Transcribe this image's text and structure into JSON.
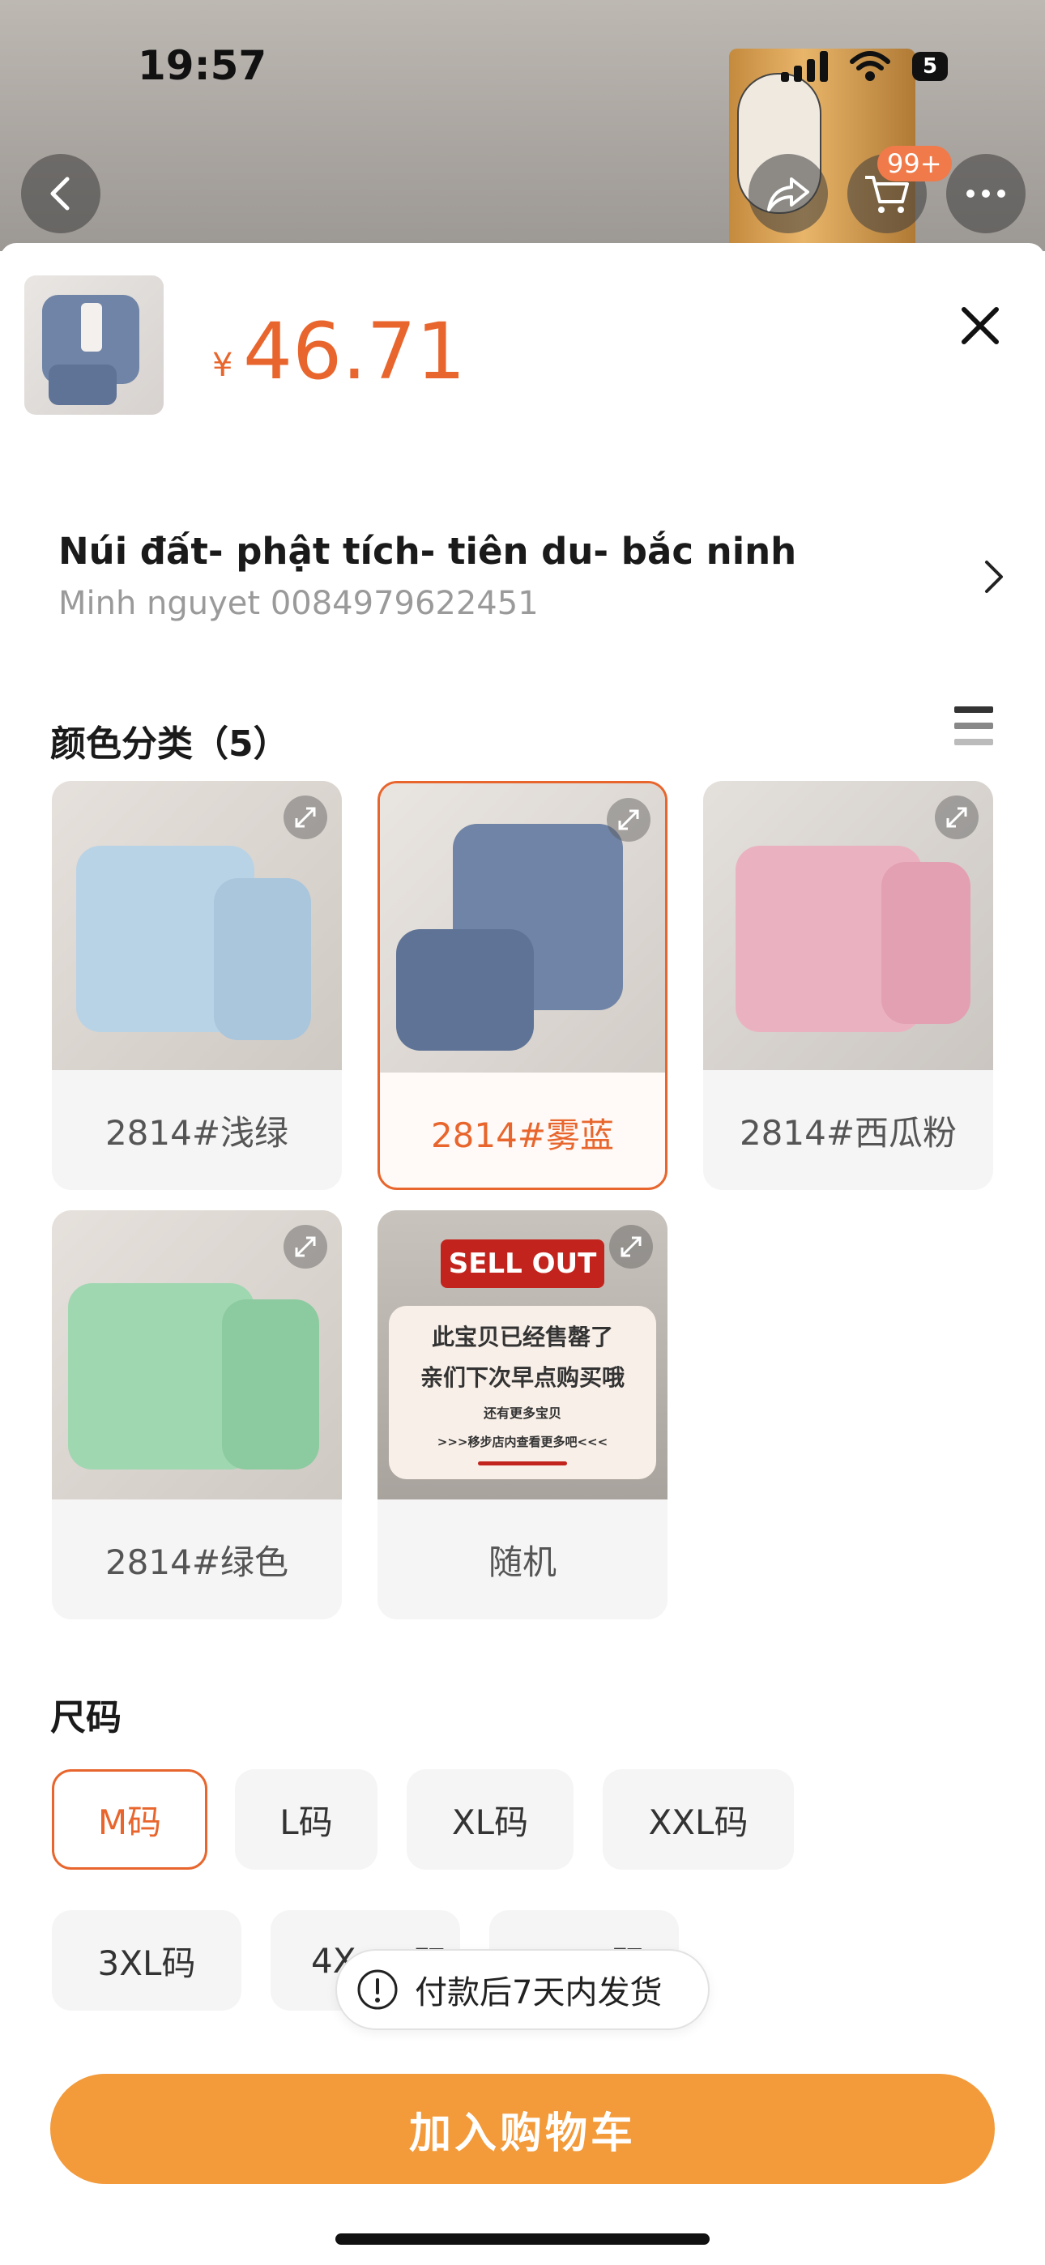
{
  "status_bar": {
    "time": "19:57",
    "battery": "5"
  },
  "nav": {
    "cart_badge": "99+",
    "back_icon": "chevron-left-icon",
    "share_icon": "share-icon",
    "cart_icon": "cart-icon",
    "more_icon": "more-icon"
  },
  "product": {
    "currency": "¥",
    "price": "46.71"
  },
  "address": {
    "title": "Núi đất- phật tích- tiên du- bắc ninh",
    "subtitle": "Minh nguyet 0084979622451"
  },
  "colors": {
    "title": "颜色分类（5）",
    "options": [
      {
        "label": "2814#浅绿",
        "swatch": "#b9d3e6",
        "selected": false
      },
      {
        "label": "2814#雾蓝",
        "swatch": "#6f84a6",
        "selected": true
      },
      {
        "label": "2814#西瓜粉",
        "swatch": "#eab2c0",
        "selected": false
      },
      {
        "label": "2814#绿色",
        "swatch": "#9fd7b1",
        "selected": false
      },
      {
        "label": "随机",
        "swatch": "#c9c3bd",
        "selected": false
      }
    ],
    "soldout": {
      "banner": "SELL OUT",
      "line1": "此宝贝已经售罄了",
      "line2": "亲们下次早点购买哦",
      "line3": "还有更多宝贝",
      "line4": ">>>移步店内查看更多吧<<<"
    }
  },
  "sizes": {
    "title": "尺码",
    "options": [
      "M码",
      "L码",
      "XL码",
      "XXL码",
      "3XL码",
      "4XL码",
      "5XL码"
    ],
    "visible_text": {
      "partial_4xl": "4X",
      "partial_4xl_tail": "码",
      "partial_5xl": "码"
    },
    "selected": "M码"
  },
  "toast": {
    "text": "付款后7天内发货"
  },
  "cta": {
    "label": "加入购物车"
  },
  "accent_color": "#e8662d",
  "cta_color": "#f39a3a"
}
